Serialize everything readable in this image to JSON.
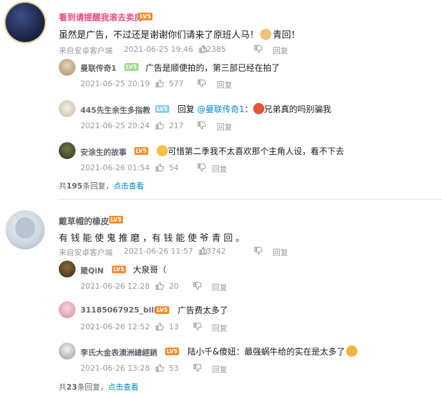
{
  "comments": [
    {
      "user": "看到请提醒我滚去卖房",
      "level": "LV5",
      "text": "虽然是广告，不过还是谢谢你们请来了原班人马！",
      "text_tail": "青回！",
      "source": "来自安卓客户端",
      "date": "2021-06-25 19:46",
      "likes": "32385",
      "reply_label": "回复",
      "replies": [
        {
          "user": "曼联传奇1",
          "level": "LV5",
          "text": "广告是顺便拍的，第三部已经在拍了",
          "date": "2021-06-25 20:19",
          "likes": "577",
          "reply_label": "回复"
        },
        {
          "user": "445先生余生多指教",
          "level": "LV5",
          "text_prefix": "回复",
          "mention": "@曼联传奇1",
          "text_suffix": "：",
          "text": "兄弟真的吗别骗我",
          "date": "2021-06-25 20:24",
          "likes": "217",
          "reply_label": "回复"
        },
        {
          "user": "安涂生的故事",
          "level": "LV5",
          "text": "可惜第二季我不太喜欢那个主角人设，看不下去",
          "date": "2021-06-26 01:54",
          "likes": "54",
          "reply_label": "回复"
        }
      ],
      "more_prefix": "共",
      "more_count": "195",
      "more_suffix": "条回复，",
      "more_link": "点击查看"
    },
    {
      "user": "戴草帽的橡皮",
      "level": "LV5",
      "text": "有 钱 能 使 鬼 推 磨 ，有 钱 能 使 爷 青 回 。",
      "source": "来自安卓客户端",
      "date": "2021-06-26 11:57",
      "likes": "13742",
      "reply_label": "回复",
      "replies": [
        {
          "user": "箴QiN",
          "level": "LV5",
          "text": "大泉哥（",
          "date": "2021-06-26 12:28",
          "likes": "20",
          "reply_label": "回复"
        },
        {
          "user": "31185067925_bili",
          "level": "LV5",
          "text": "广告费太多了",
          "date": "2021-06-26 12:52",
          "likes": "13",
          "reply_label": "回复"
        },
        {
          "user": "李氏大金表澳洲總經銷",
          "level": "LV5",
          "text": "陆小千&傻妞：最强蜗牛给的实在是太多了",
          "date": "2021-06-26 13:28",
          "likes": "53",
          "reply_label": "回复"
        }
      ],
      "more_prefix": "共",
      "more_count": "23",
      "more_suffix": "条回复，",
      "more_link": "点击查看"
    }
  ],
  "colors": {
    "accent": "#008ac5",
    "pink_name": "#e84b85",
    "level_badge": "#f58b2a",
    "meta": "#9499a0"
  },
  "icons": {
    "like": "thumb-up-icon"
  }
}
